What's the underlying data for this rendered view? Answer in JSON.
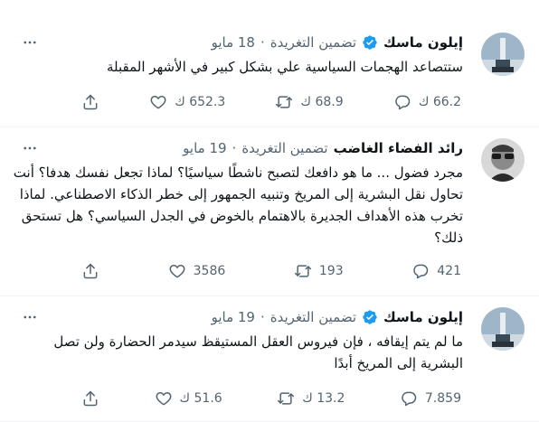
{
  "tweets": [
    {
      "author_name": "إيلون ماسك",
      "date": "18 مايو",
      "separator": "·",
      "embed_label": "تضمين التغريدة",
      "text": "ستتصاعد الهجمات السياسية علي بشكل كبير في الأشهر المقبلة",
      "replies": "66.2 ك",
      "retweets": "68.9 ك",
      "likes": "652.3 ك",
      "verified": true
    },
    {
      "author_name": "رائد الفضاء الغاضب",
      "date": "19 مايو",
      "separator": "·",
      "embed_label": "تضمين التغريدة",
      "text": "مجرد فضول ... ما هو دافعك لتصبح ناشطًا سياسيًا؟ لماذا تجعل نفسك هدفا؟ أنت تحاول نقل البشرية إلى المريخ وتنبيه الجمهور إلى خطر الذكاء الاصطناعي. لماذا تخرب هذه الأهداف الجديرة بالاهتمام بالخوض في الجدل السياسي؟ هل تستحق ذلك؟",
      "replies": "421",
      "retweets": "193",
      "likes": "3586",
      "verified": false
    },
    {
      "author_name": "إيلون ماسك",
      "date": "19 مايو",
      "separator": "·",
      "embed_label": "تضمين التغريدة",
      "text": "ما لم يتم إيقافه ، فإن فيروس العقل المستيقظ سيدمر الحضارة ولن تصل البشرية إلى المريخ أبدًا",
      "replies": "7.859",
      "retweets": "13.2 ك",
      "likes": "51.6 ك",
      "verified": true
    }
  ],
  "icons": {
    "verified": "verified-badge-icon",
    "more": "more-options-icon",
    "reply": "reply-icon",
    "retweet": "retweet-icon",
    "like": "like-icon",
    "share": "share-icon"
  },
  "colors": {
    "verified_blue": "#1d9bf0",
    "text": "#0f1419",
    "secondary": "#536471"
  }
}
